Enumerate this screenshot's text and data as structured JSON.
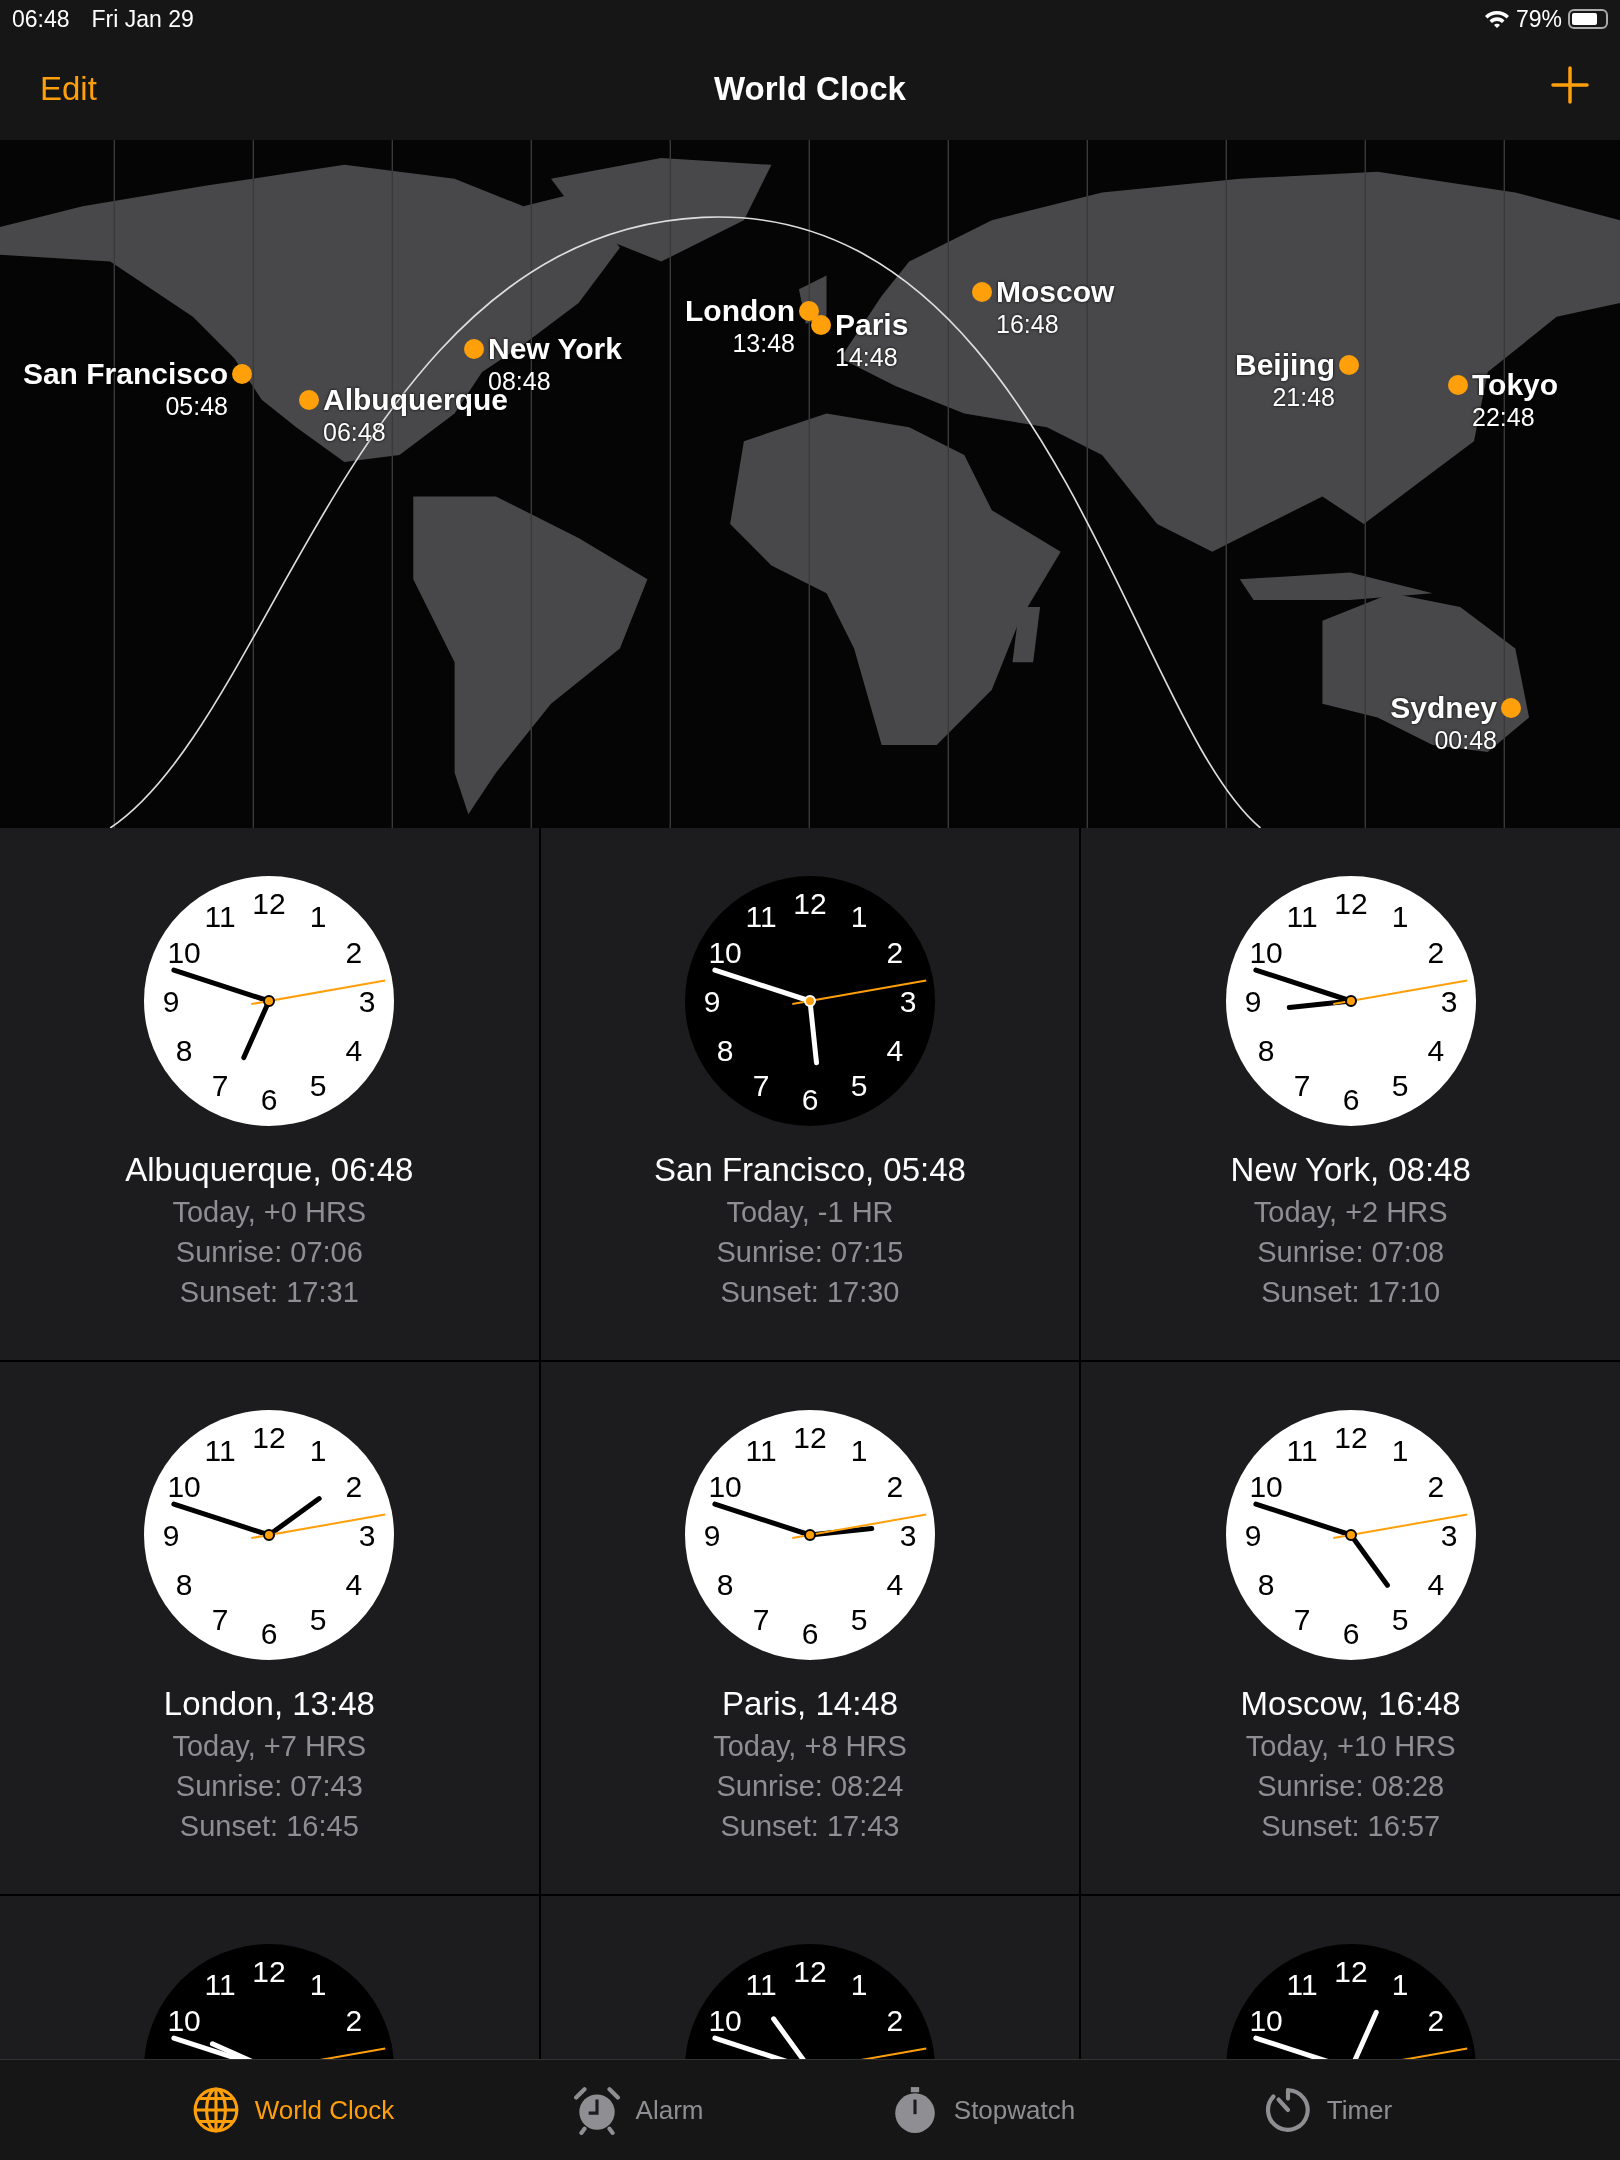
{
  "status_bar": {
    "time": "06:48",
    "date": "Fri Jan 29",
    "battery_text": "79%",
    "battery": {
      "level": 0.79
    }
  },
  "nav_bar": {
    "edit": "Edit",
    "title": "World Clock"
  },
  "map": {
    "pins": [
      {
        "city": "San Francisco",
        "time": "05:48"
      },
      {
        "city": "Albuquerque",
        "time": "06:48"
      },
      {
        "city": "New York",
        "time": "08:48"
      },
      {
        "city": "London",
        "time": "13:48"
      },
      {
        "city": "Paris",
        "time": "14:48"
      },
      {
        "city": "Moscow",
        "time": "16:48"
      },
      {
        "city": "Beijing",
        "time": "21:48"
      },
      {
        "city": "Tokyo",
        "time": "22:48"
      },
      {
        "city": "Sydney",
        "time": "00:48"
      }
    ]
  },
  "clocks": [
    {
      "title": "Albuquerque, 06:48",
      "night": false,
      "lines": [
        "Today, +0 HRS",
        "Sunrise: 07:06",
        "Sunset: 17:31"
      ],
      "numerals": [
        "11",
        "12",
        "1",
        "10",
        "2",
        "9",
        "3",
        "8",
        "4",
        "7",
        "6",
        "5"
      ]
    },
    {
      "title": "San Francisco, 05:48",
      "night": true,
      "lines": [
        "Today, -1 HR",
        "Sunrise: 07:15",
        "Sunset: 17:30"
      ],
      "numerals": [
        "11",
        "12",
        "1",
        "10",
        "2",
        "9",
        "3",
        "8",
        "4",
        "7",
        "6",
        "5"
      ]
    },
    {
      "title": "New York, 08:48",
      "night": false,
      "lines": [
        "Today, +2 HRS",
        "Sunrise: 07:08",
        "Sunset: 17:10"
      ],
      "numerals": [
        "11",
        "12",
        "1",
        "10",
        "2",
        "9",
        "3",
        "8",
        "4",
        "7",
        "6",
        "5"
      ]
    },
    {
      "title": "London, 13:48",
      "night": false,
      "lines": [
        "Today, +7 HRS",
        "Sunrise: 07:43",
        "Sunset: 16:45"
      ],
      "numerals": [
        "11",
        "12",
        "1",
        "10",
        "2",
        "9",
        "3",
        "8",
        "4",
        "7",
        "6",
        "5"
      ]
    },
    {
      "title": "Paris, 14:48",
      "night": false,
      "lines": [
        "Today, +8 HRS",
        "Sunrise: 08:24",
        "Sunset: 17:43"
      ],
      "numerals": [
        "11",
        "12",
        "1",
        "10",
        "2",
        "9",
        "3",
        "8",
        "4",
        "7",
        "6",
        "5"
      ]
    },
    {
      "title": "Moscow, 16:48",
      "night": false,
      "lines": [
        "Today, +10 HRS",
        "Sunrise: 08:28",
        "Sunset: 16:57"
      ],
      "numerals": [
        "11",
        "12",
        "1",
        "10",
        "2",
        "9",
        "3",
        "8",
        "4",
        "7",
        "6",
        "5"
      ]
    },
    {
      "night": true,
      "numerals": [
        "11",
        "12",
        "1",
        "10",
        "2"
      ]
    },
    {
      "night": true,
      "numerals": [
        "11",
        "12",
        "1",
        "10",
        "2"
      ]
    },
    {
      "night": true,
      "numerals": [
        "11",
        "12",
        "1",
        "10",
        "2"
      ]
    }
  ],
  "tabs": [
    {
      "label": "World Clock",
      "selected": true
    },
    {
      "label": "Alarm",
      "selected": false
    },
    {
      "label": "Stopwatch",
      "selected": false
    },
    {
      "label": "Timer",
      "selected": false
    }
  ]
}
